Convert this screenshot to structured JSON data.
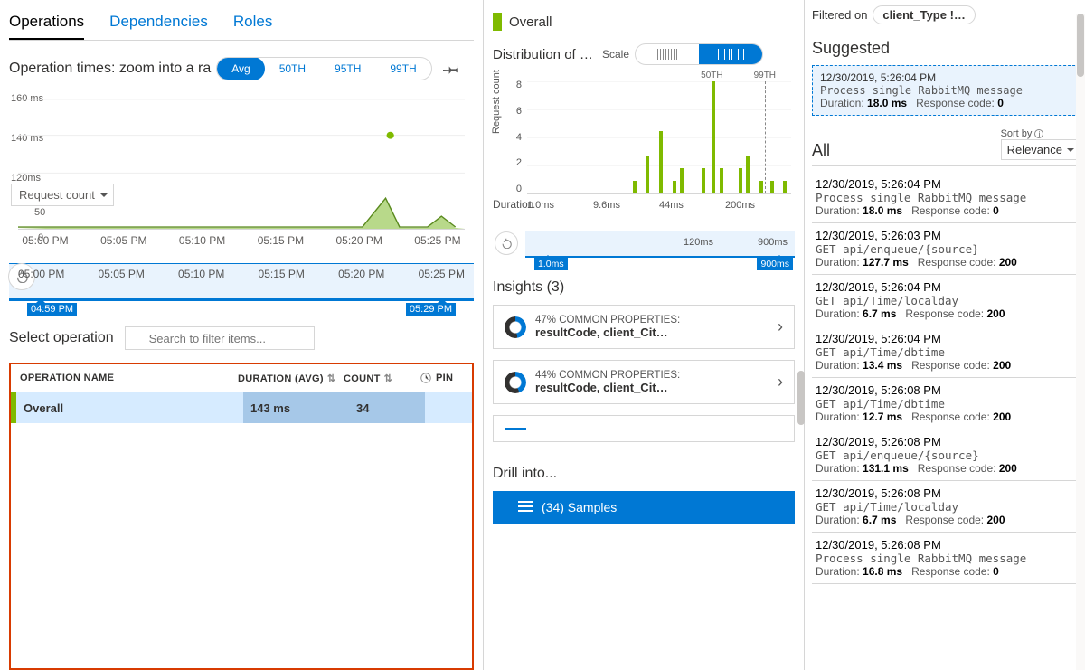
{
  "tabs": {
    "operations": "Operations",
    "dependencies": "Dependencies",
    "roles": "Roles"
  },
  "left": {
    "section_label": "Operation times: zoom into a ra",
    "percentiles": {
      "avg": "Avg",
      "p50": "50TH",
      "p95": "95TH",
      "p99": "99TH"
    },
    "y_metric_dd": "Request count",
    "brush_start": "04:59 PM",
    "brush_end": "05:29 PM",
    "select_label": "Select operation",
    "search_placeholder": "Search to filter items...",
    "columns": {
      "name": "OPERATION NAME",
      "dur": "DURATION (AVG)",
      "cnt": "COUNT",
      "pin": "PIN"
    },
    "row": {
      "name": "Overall",
      "dur": "143 ms",
      "cnt": "34"
    }
  },
  "mid": {
    "overall": "Overall",
    "dist_label_full": "Distribution of d…",
    "scale_label": "Scale",
    "insights_label": "Insights (3)",
    "insight1_top": "47% COMMON PROPERTIES:",
    "insight1_bot": "resultCode, client_Cit…",
    "insight2_top": "44% COMMON PROPERTIES:",
    "insight2_bot": "resultCode, client_Cit…",
    "drill_label": "Drill into...",
    "samples_btn": "(34) Samples",
    "dist_brush_mid": "120ms",
    "dist_brush_end": "900ms",
    "dist_tag_start": "1.0ms",
    "dist_tag_end": "900ms"
  },
  "right": {
    "filtered_label": "Filtered on",
    "filtered_chip": "client_Type !…",
    "suggested_label": "Suggested",
    "sugg_ts": "12/30/2019, 5:26:04 PM",
    "sugg_op": "Process single RabbitMQ message",
    "sugg_dur": "18.0 ms",
    "sugg_code": "0",
    "all_label": "All",
    "sort_label": "Sort by",
    "sort_value": "Relevance",
    "dur_word": "Duration:",
    "code_word": "Response code:",
    "list": [
      {
        "ts": "12/30/2019, 5:26:04 PM",
        "op": "Process single RabbitMQ message",
        "dur": "18.0 ms",
        "code": "0"
      },
      {
        "ts": "12/30/2019, 5:26:03 PM",
        "op": "GET api/enqueue/{source}",
        "dur": "127.7 ms",
        "code": "200"
      },
      {
        "ts": "12/30/2019, 5:26:04 PM",
        "op": "GET api/Time/localday",
        "dur": "6.7 ms",
        "code": "200"
      },
      {
        "ts": "12/30/2019, 5:26:04 PM",
        "op": "GET api/Time/dbtime",
        "dur": "13.4 ms",
        "code": "200"
      },
      {
        "ts": "12/30/2019, 5:26:08 PM",
        "op": "GET api/Time/dbtime",
        "dur": "12.7 ms",
        "code": "200"
      },
      {
        "ts": "12/30/2019, 5:26:08 PM",
        "op": "GET api/enqueue/{source}",
        "dur": "131.1 ms",
        "code": "200"
      },
      {
        "ts": "12/30/2019, 5:26:08 PM",
        "op": "GET api/Time/localday",
        "dur": "6.7 ms",
        "code": "200"
      },
      {
        "ts": "12/30/2019, 5:26:08 PM",
        "op": "Process single RabbitMQ message",
        "dur": "16.8 ms",
        "code": "0"
      }
    ]
  },
  "chart_data": [
    {
      "id": "operation_times_line",
      "type": "line",
      "title": "Operation times",
      "x_ticks": [
        "05:00 PM",
        "05:05 PM",
        "05:10 PM",
        "05:15 PM",
        "05:20 PM",
        "05:25 PM"
      ],
      "y_ticks_ms": [
        "160 ms",
        "140 ms",
        "120ms"
      ],
      "y_ticks_count": [
        50,
        0
      ],
      "outlier": {
        "x": "05:23 PM",
        "y_ms": 140
      },
      "series": [
        {
          "name": "Request count (bottom sparkline)",
          "x": [
            "05:00 PM",
            "05:05 PM",
            "05:10 PM",
            "05:15 PM",
            "05:20 PM",
            "05:23 PM",
            "05:25 PM",
            "05:27 PM"
          ],
          "values": [
            2,
            2,
            2,
            2,
            2,
            48,
            2,
            20
          ]
        }
      ],
      "ylim": [
        0,
        160
      ]
    },
    {
      "id": "distribution_histogram",
      "type": "bar",
      "title": "Distribution of durations",
      "xlabel": "Duration",
      "ylabel": "Request count",
      "x_ticks": [
        "1.0ms",
        "9.6ms",
        "44ms",
        "200ms"
      ],
      "y_ticks": [
        0,
        2,
        4,
        6,
        8
      ],
      "percentile_markers": {
        "50TH": "44ms",
        "99TH": "200ms"
      },
      "bins": [
        {
          "x": "1.0ms",
          "count": 0
        },
        {
          "x": "5ms",
          "count": 0
        },
        {
          "x": "9ms",
          "count": 1
        },
        {
          "x": "11ms",
          "count": 3
        },
        {
          "x": "14ms",
          "count": 5
        },
        {
          "x": "18ms",
          "count": 1
        },
        {
          "x": "22ms",
          "count": 2
        },
        {
          "x": "42ms",
          "count": 2
        },
        {
          "x": "44ms",
          "count": 9
        },
        {
          "x": "48ms",
          "count": 2
        },
        {
          "x": "130ms",
          "count": 2
        },
        {
          "x": "140ms",
          "count": 3
        },
        {
          "x": "180ms",
          "count": 1
        },
        {
          "x": "260ms",
          "count": 1
        },
        {
          "x": "300ms",
          "count": 1
        }
      ],
      "ylim": [
        0,
        9
      ]
    }
  ]
}
